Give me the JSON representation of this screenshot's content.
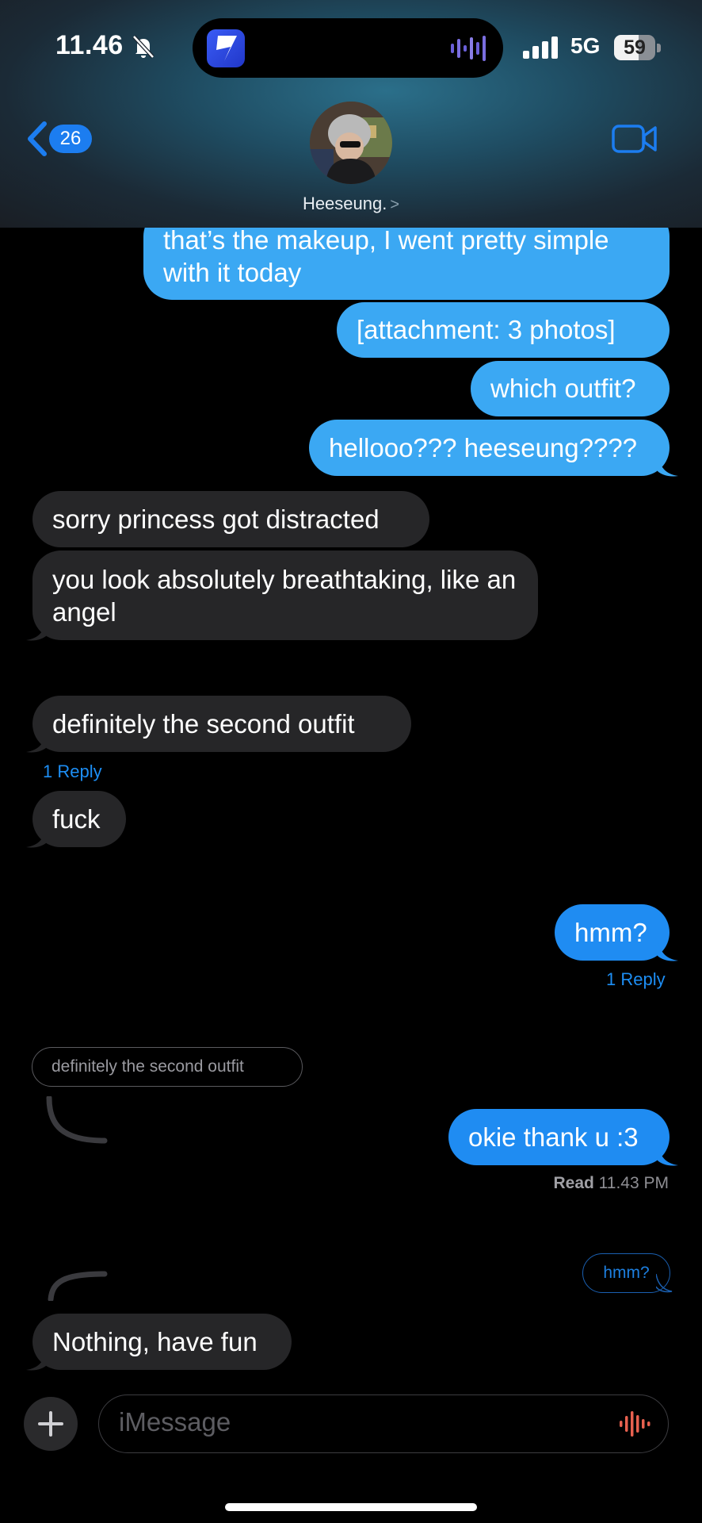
{
  "status_bar": {
    "time": "11.46",
    "network": "5G",
    "battery_percent": "59",
    "battery_level": 0.59
  },
  "nav": {
    "back_count": "26",
    "contact_name": "Heeseung.",
    "contact_chevron": ">"
  },
  "messages": {
    "m1": "that’s the makeup, I went pretty simple with it today",
    "m2": "[attachment: 3 photos]",
    "m3": "which outfit?",
    "m4": "hellooo??? heeseung????",
    "m5": "sorry princess got distracted",
    "m6": "you look absolutely breathtaking, like an angel",
    "m7": "definitely the second outfit",
    "m7_reply": "1 Reply",
    "m8": "fuck",
    "m9": "hmm?",
    "m9_reply": "1 Reply",
    "quote_in": "definitely the second outfit",
    "m10": "okie thank u :3",
    "read_label": "Read",
    "read_time": "11.43 PM",
    "quote_out": "hmm?",
    "m11": "Nothing, have fun"
  },
  "composer": {
    "placeholder": "iMessage",
    "plus_icon": "plus-icon",
    "mic_icon": "waveform-icon"
  },
  "colors": {
    "outgoing": "#3ba8f3",
    "incoming": "#262628",
    "accent": "#1d8ef4"
  }
}
